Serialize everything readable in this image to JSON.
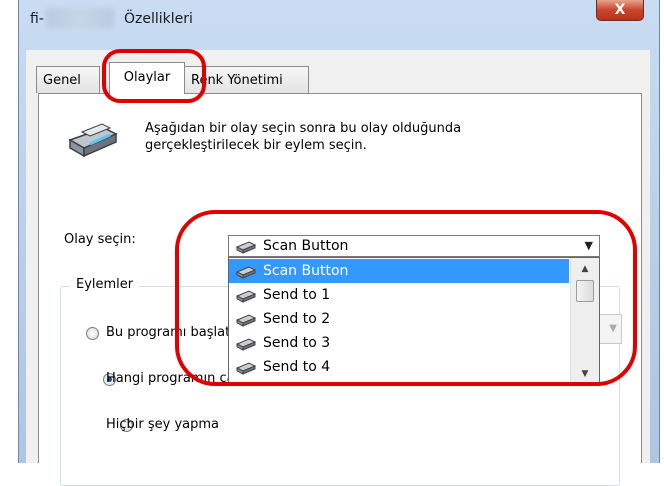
{
  "window": {
    "title_prefix": "fi-",
    "title_name": "Özellikleri",
    "close_label": "X"
  },
  "tabs": [
    {
      "label": "Genel",
      "active": false
    },
    {
      "label": "Olaylar",
      "active": true
    },
    {
      "label": "Renk Yönetimi",
      "active": false
    }
  ],
  "event_section": {
    "description": "Aşağıdan bir olay seçin sonra bu olay olduğunda gerçekleştirilecek bir eylem seçin.",
    "select_label": "Olay seçin:",
    "selected_value": "Scan Button",
    "options": [
      "Scan Button",
      "Send to 1",
      "Send to 2",
      "Send to 3",
      "Send to 4"
    ],
    "highlighted_option": "Scan Button"
  },
  "actions": {
    "group_title": "Eylemler",
    "options": [
      {
        "label": "Bu programı başlat",
        "selected": false
      },
      {
        "label": "Hangi programın çalıştırılacağını sor",
        "selected": true
      },
      {
        "label": "Hiçbir şey yapma",
        "selected": false
      }
    ]
  },
  "annotation_color": "#e00000",
  "selection_color": "#3399ff"
}
